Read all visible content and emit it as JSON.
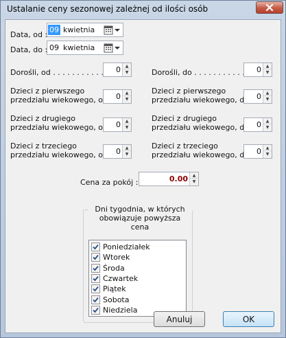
{
  "window": {
    "title": "Ustalanie ceny sezonowej zależnej od ilości osób"
  },
  "date_from": {
    "label": "Data, od :",
    "day": "09",
    "month": "kwietnia"
  },
  "date_to": {
    "label": "Data, do :",
    "day": "09",
    "month": "kwietnia"
  },
  "fields": {
    "adults_from": {
      "label": "Dorośli, od . . . . . . . . . . . .",
      "value": "0"
    },
    "adults_to": {
      "label": "Dorośli, do . . . . . . . . . . . .",
      "value": "0"
    },
    "kids1_from": {
      "line1": "Dzieci z pierwszego",
      "line2": "przedziału wiekowego, od .",
      "value": "0"
    },
    "kids1_to": {
      "line1": "Dzieci z pierwszego",
      "line2": "przedziału wiekowego, do .",
      "value": "0"
    },
    "kids2_from": {
      "line1": "Dzieci z drugiego",
      "line2": "przedziału wiekowego, od",
      "value": "0"
    },
    "kids2_to": {
      "line1": "Dzieci z drugiego",
      "line2": "przedziału wiekowego, do",
      "value": "0"
    },
    "kids3_from": {
      "line1": "Dzieci z trzeciego",
      "line2": "przedziału wiekowego, od .",
      "value": "0"
    },
    "kids3_to": {
      "line1": "Dzieci z trzeciego",
      "line2": "przedziału wiekowego, do .",
      "value": "0"
    }
  },
  "price": {
    "label": "Cena za pokój :",
    "value": "0.00"
  },
  "weekdays": {
    "title_line1": "Dni tygodnia, w których",
    "title_line2": "obowiązuje powyższa cena",
    "items": [
      {
        "label": "Poniedziałek",
        "checked": true
      },
      {
        "label": "Wtorek",
        "checked": true
      },
      {
        "label": "Środa",
        "checked": true
      },
      {
        "label": "Czwartek",
        "checked": true
      },
      {
        "label": "Piątek",
        "checked": true
      },
      {
        "label": "Sobota",
        "checked": true
      },
      {
        "label": "Niedziela",
        "checked": true
      }
    ]
  },
  "buttons": {
    "cancel": "Anuluj",
    "ok": "OK"
  },
  "colors": {
    "price_value": "#8b0000",
    "selection": "#3399ff"
  },
  "icons": {
    "close": "close-icon",
    "calendar": "calendar-dropdown-icon",
    "check": "checkmark-icon"
  }
}
